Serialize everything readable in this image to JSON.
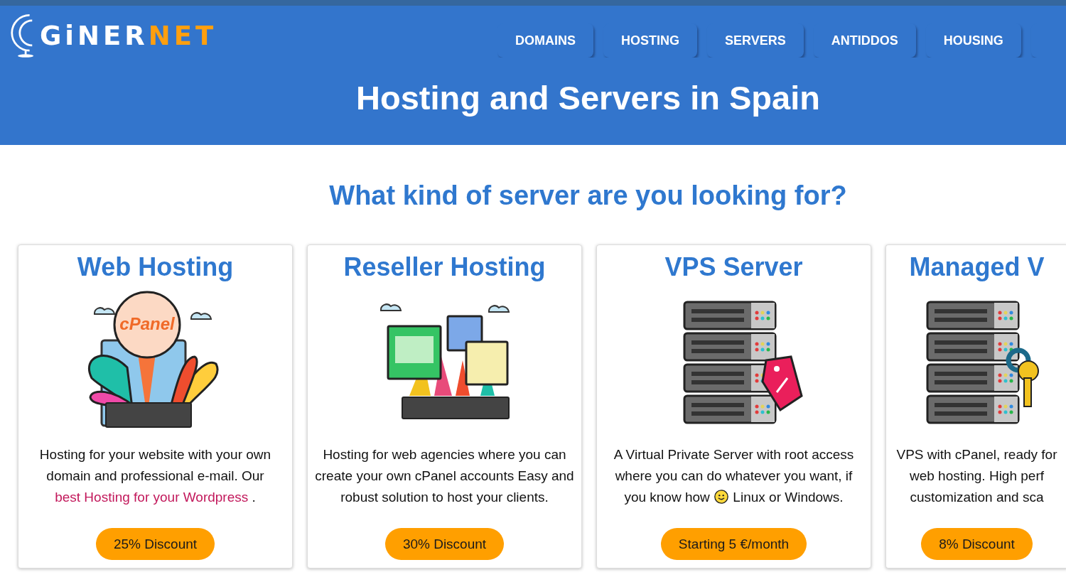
{
  "header": {
    "logo": {
      "first": "GiNER",
      "second": "NET"
    },
    "nav": [
      {
        "label": "DOMAINS"
      },
      {
        "label": "HOSTING"
      },
      {
        "label": "SERVERS"
      },
      {
        "label": "ANTIDDOS"
      },
      {
        "label": "HOUSING"
      }
    ],
    "title": "Hosting and Servers in Spain"
  },
  "section": {
    "heading": "What kind of server are you looking for?",
    "cards": [
      {
        "title": "Web Hosting",
        "kind": "cpanel",
        "image_label": "cPanel",
        "description": [
          {
            "kind": "text",
            "text": "Hosting for your website with your own domain and professional e-mail. Our"
          },
          {
            "kind": "link",
            "text": "best Hosting for your Wordpress"
          },
          {
            "kind": "text",
            "text": "."
          }
        ],
        "button": "25% Discount"
      },
      {
        "title": "Reseller Hosting",
        "kind": "reseller",
        "description": [
          {
            "kind": "text",
            "text": "Hosting for web agencies where you can create your own cPanel accounts Easy and robust solution to host your clients."
          }
        ],
        "button": "30% Discount"
      },
      {
        "title": "VPS Server",
        "kind": "pricetag",
        "description": [
          {
            "kind": "text",
            "text": "A Virtual Private Server with root access where you can do whatever you want, if you know how"
          },
          {
            "kind": "smiley"
          },
          {
            "kind": "text",
            "text": "Linux or Windows."
          }
        ],
        "button": "Starting 5 €/month"
      },
      {
        "title": "Managed V",
        "kind": "keys",
        "description": [
          {
            "kind": "text",
            "text": "VPS with cPanel, ready for"
          },
          {
            "kind": "break"
          },
          {
            "kind": "text",
            "text": "web hosting. High perf"
          },
          {
            "kind": "break"
          },
          {
            "kind": "text",
            "text": "customization and sca"
          }
        ],
        "button": "8% Discount"
      }
    ]
  }
}
